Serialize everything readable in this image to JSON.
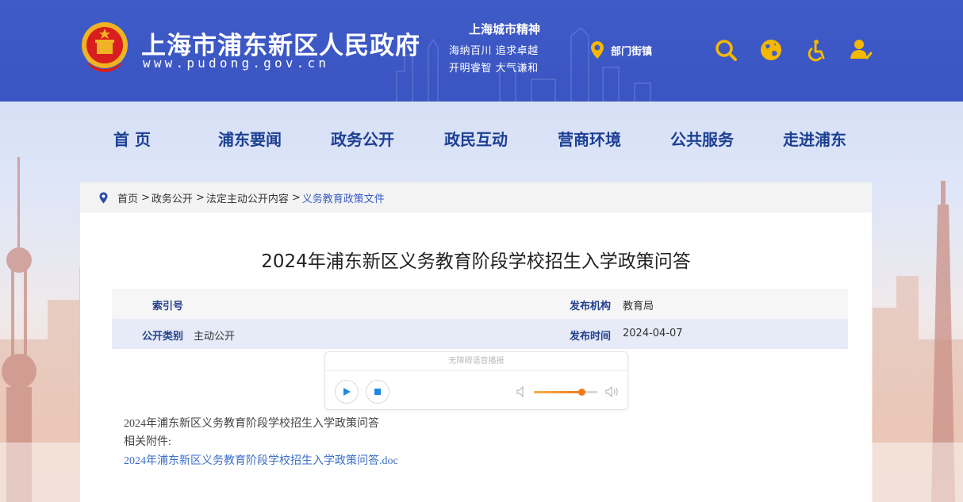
{
  "header": {
    "site_title": "上海市浦东新区人民政府",
    "site_url": "www.pudong.gov.cn",
    "spirit": {
      "title": "上海城市精神",
      "line1": "海纳百川  追求卓越",
      "line2": "开明睿智  大气谦和"
    },
    "dept_link": "部门街镇",
    "icons": [
      "search-icon",
      "globe-icon",
      "accessibility-icon",
      "user-icon"
    ],
    "colors": {
      "bar": "#3f5bc7",
      "accent": "#f5b800"
    }
  },
  "nav": {
    "items": [
      "首  页",
      "浦东要闻",
      "政务公开",
      "政民互动",
      "营商环境",
      "公共服务",
      "走进浦东"
    ]
  },
  "breadcrumb": {
    "items": [
      "首页",
      "政务公开",
      "法定主动公开内容",
      "义务教育政策文件"
    ],
    "separator": ">"
  },
  "article": {
    "title": "2024年浦东新区义务教育阶段学校招生入学政策问答",
    "meta": {
      "index_label": "索引号",
      "index_value": "",
      "org_label": "发布机构",
      "org_value": "教育局",
      "type_label": "公开类别",
      "type_value": "主动公开",
      "date_label": "发布时间",
      "date_value": "2024-04-07"
    },
    "player": {
      "label": "无障碍语音播报",
      "volume": 0.75
    },
    "body_line1": "2024年浦东新区义务教育阶段学校招生入学政策问答",
    "attachments_label": "相关附件:",
    "attachment_file": "2024年浦东新区义务教育阶段学校招生入学政策问答.doc"
  }
}
